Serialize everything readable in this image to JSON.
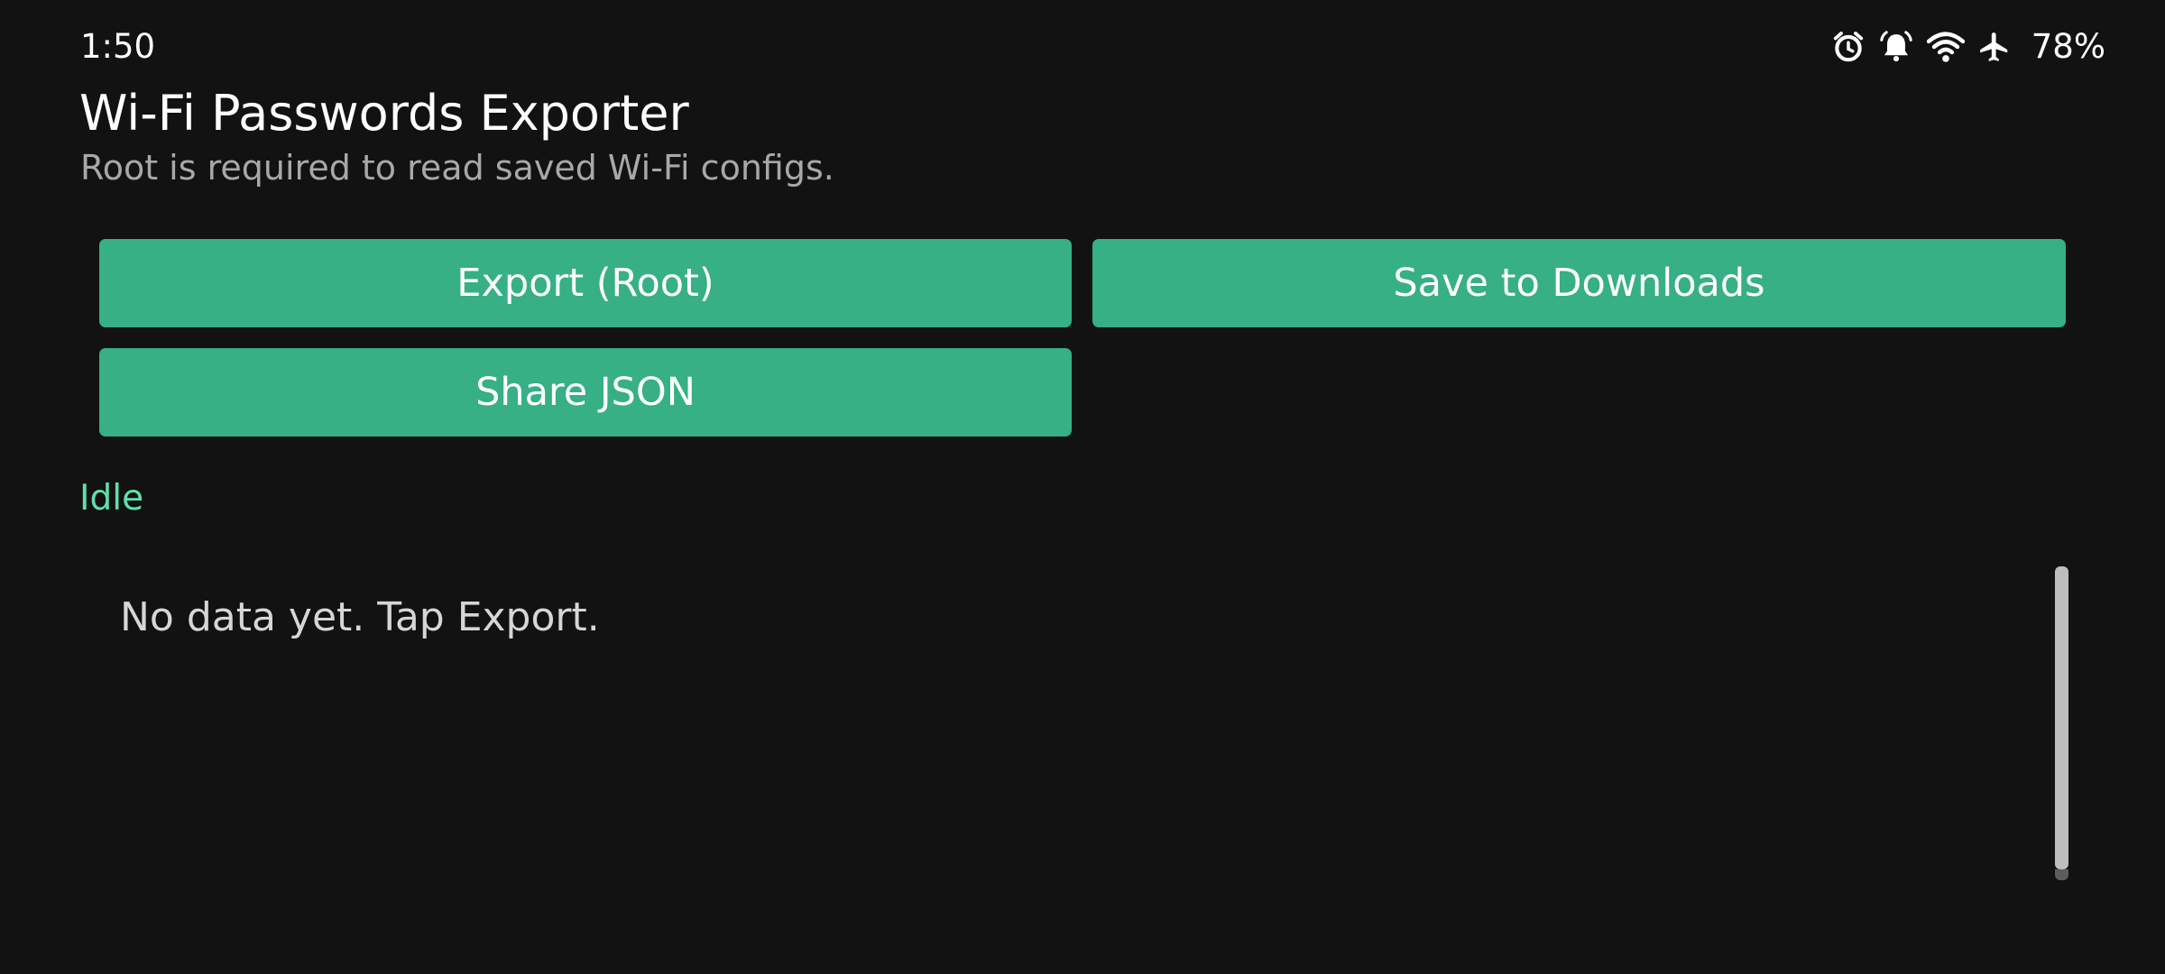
{
  "status_bar": {
    "time": "1:50",
    "icons": [
      "alarm-icon",
      "alarm-bell-icon",
      "wifi-icon",
      "airplane-icon"
    ],
    "battery": "78%"
  },
  "header": {
    "title": "Wi-Fi Passwords Exporter",
    "subtitle": "Root is required to read saved Wi-Fi configs."
  },
  "buttons": {
    "export_label": "Export (Root)",
    "save_label": "Save to Downloads",
    "share_label": "Share JSON"
  },
  "status": {
    "text": "Idle"
  },
  "output": {
    "text": "No data yet. Tap Export."
  },
  "colors": {
    "background": "#121212",
    "button": "#36b084",
    "status_text": "#5fe0a8",
    "subtitle": "#a8a8a8"
  }
}
